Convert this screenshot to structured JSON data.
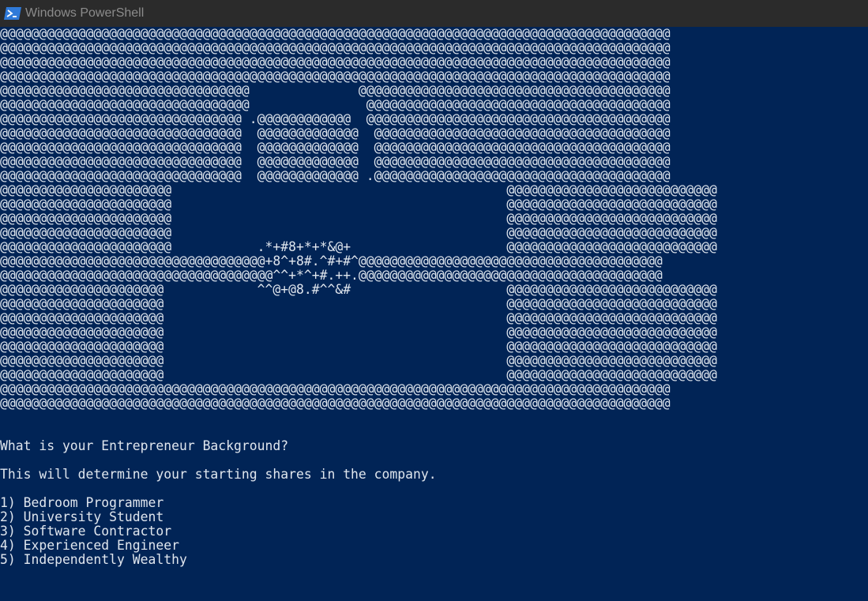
{
  "window": {
    "title": "Windows PowerShell",
    "app_icon": "powershell-icon"
  },
  "colors": {
    "console_background": "#012456",
    "console_text": "#e0e6ee",
    "titlebar_background": "#2b2b2b",
    "titlebar_text": "#8c8c8c"
  },
  "ascii_art": [
    "@@@@@@@@@@@@@@@@@@@@@@@@@@@@@@@@@@@@@@@@@@@@@@@@@@@@@@@@@@@@@@@@@@@@@@@@@@@@@@@@@@@@@@",
    "@@@@@@@@@@@@@@@@@@@@@@@@@@@@@@@@@@@@@@@@@@@@@@@@@@@@@@@@@@@@@@@@@@@@@@@@@@@@@@@@@@@@@@",
    "@@@@@@@@@@@@@@@@@@@@@@@@@@@@@@@@@@@@@@@@@@@@@@@@@@@@@@@@@@@@@@@@@@@@@@@@@@@@@@@@@@@@@@",
    "@@@@@@@@@@@@@@@@@@@@@@@@@@@@@@@@@@@@@@@@@@@@@@@@@@@@@@@@@@@@@@@@@@@@@@@@@@@@@@@@@@@@@@",
    "@@@@@@@@@@@@@@@@@@@@@@@@@@@@@@@@              @@@@@@@@@@@@@@@@@@@@@@@@@@@@@@@@@@@@@@@@",
    "@@@@@@@@@@@@@@@@@@@@@@@@@@@@@@@@               @@@@@@@@@@@@@@@@@@@@@@@@@@@@@@@@@@@@@@@",
    "@@@@@@@@@@@@@@@@@@@@@@@@@@@@@@@ .@@@@@@@@@@@@  @@@@@@@@@@@@@@@@@@@@@@@@@@@@@@@@@@@@@@@",
    "@@@@@@@@@@@@@@@@@@@@@@@@@@@@@@@  @@@@@@@@@@@@@  @@@@@@@@@@@@@@@@@@@@@@@@@@@@@@@@@@@@@@",
    "@@@@@@@@@@@@@@@@@@@@@@@@@@@@@@@  @@@@@@@@@@@@@  @@@@@@@@@@@@@@@@@@@@@@@@@@@@@@@@@@@@@@",
    "@@@@@@@@@@@@@@@@@@@@@@@@@@@@@@@  @@@@@@@@@@@@@  @@@@@@@@@@@@@@@@@@@@@@@@@@@@@@@@@@@@@@",
    "@@@@@@@@@@@@@@@@@@@@@@@@@@@@@@@  @@@@@@@@@@@@@ .@@@@@@@@@@@@@@@@@@@@@@@@@@@@@@@@@@@@@@",
    "@@@@@@@@@@@@@@@@@@@@@@                                           @@@@@@@@@@@@@@@@@@@@@@@@@@@",
    "@@@@@@@@@@@@@@@@@@@@@@                                           @@@@@@@@@@@@@@@@@@@@@@@@@@@",
    "@@@@@@@@@@@@@@@@@@@@@@                                           @@@@@@@@@@@@@@@@@@@@@@@@@@@",
    "@@@@@@@@@@@@@@@@@@@@@@                                           @@@@@@@@@@@@@@@@@@@@@@@@@@@",
    "@@@@@@@@@@@@@@@@@@@@@@           .*+#8+*+*&@+                    @@@@@@@@@@@@@@@@@@@@@@@@@@@",
    "@@@@@@@@@@@@@@@@@@@@@@@@@@@@@@@@@@+8^+8#.^#+#^@@@@@@@@@@@@@@@@@@@@@@@@@@@@@@@@@@@@@@@",
    "@@@@@@@@@@@@@@@@@@@@@@@@@@@@@@@@@@@^^+*^+#.++.@@@@@@@@@@@@@@@@@@@@@@@@@@@@@@@@@@@@@@@",
    "@@@@@@@@@@@@@@@@@@@@@            ^^@+@8.#^^&#                    @@@@@@@@@@@@@@@@@@@@@@@@@@@",
    "@@@@@@@@@@@@@@@@@@@@@                                            @@@@@@@@@@@@@@@@@@@@@@@@@@@",
    "@@@@@@@@@@@@@@@@@@@@@                                            @@@@@@@@@@@@@@@@@@@@@@@@@@@",
    "@@@@@@@@@@@@@@@@@@@@@                                            @@@@@@@@@@@@@@@@@@@@@@@@@@@",
    "@@@@@@@@@@@@@@@@@@@@@                                            @@@@@@@@@@@@@@@@@@@@@@@@@@@",
    "@@@@@@@@@@@@@@@@@@@@@                                            @@@@@@@@@@@@@@@@@@@@@@@@@@@",
    "@@@@@@@@@@@@@@@@@@@@@                                            @@@@@@@@@@@@@@@@@@@@@@@@@@@",
    "@@@@@@@@@@@@@@@@@@@@@@@@@@@@@@@@@@@@@@@@@@@@@@@@@@@@@@@@@@@@@@@@@@@@@@@@@@@@@@@@@@@@@@",
    "@@@@@@@@@@@@@@@@@@@@@@@@@@@@@@@@@@@@@@@@@@@@@@@@@@@@@@@@@@@@@@@@@@@@@@@@@@@@@@@@@@@@@@"
  ],
  "prompt": {
    "question": "What is your Entrepreneur Background?",
    "info": "This will determine your starting shares in the company.",
    "options": [
      "1) Bedroom Programmer",
      "2) University Student",
      "3) Software Contractor",
      "4) Experienced Engineer",
      "5) Independently Wealthy"
    ]
  }
}
